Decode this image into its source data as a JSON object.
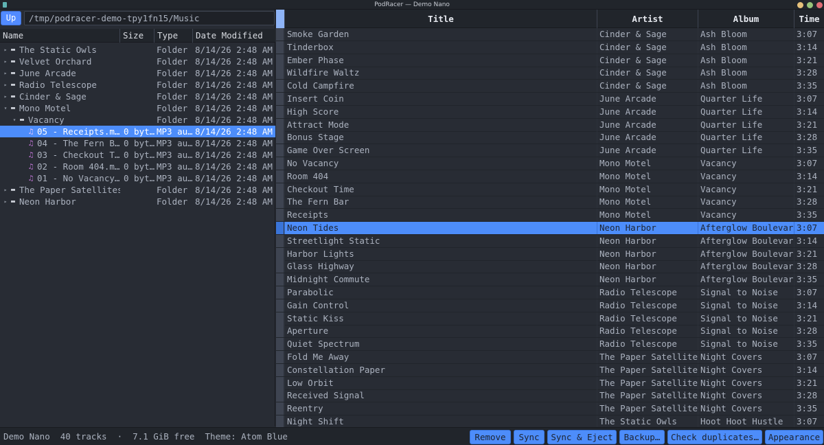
{
  "window": {
    "title": "PodRacer — Demo Nano"
  },
  "browser": {
    "up_label": "Up",
    "path": "/tmp/podracer-demo-tpy1fn15/Music",
    "columns": [
      "Name",
      "Size",
      "Type",
      "Date Modified"
    ],
    "items": [
      {
        "name": "The Static Owls",
        "size": "",
        "type": "Folder",
        "date": "8/14/26 2:48 AM",
        "kind": "folder",
        "expanded": false,
        "depth": 0
      },
      {
        "name": "Velvet Orchard",
        "size": "",
        "type": "Folder",
        "date": "8/14/26 2:48 AM",
        "kind": "folder",
        "expanded": false,
        "depth": 0
      },
      {
        "name": "June Arcade",
        "size": "",
        "type": "Folder",
        "date": "8/14/26 2:48 AM",
        "kind": "folder",
        "expanded": false,
        "depth": 0
      },
      {
        "name": "Radio Telescope",
        "size": "",
        "type": "Folder",
        "date": "8/14/26 2:48 AM",
        "kind": "folder",
        "expanded": false,
        "depth": 0
      },
      {
        "name": "Cinder & Sage",
        "size": "",
        "type": "Folder",
        "date": "8/14/26 2:48 AM",
        "kind": "folder",
        "expanded": false,
        "depth": 0
      },
      {
        "name": "Mono Motel",
        "size": "",
        "type": "Folder",
        "date": "8/14/26 2:48 AM",
        "kind": "folder",
        "expanded": true,
        "depth": 0
      },
      {
        "name": "Vacancy",
        "size": "",
        "type": "Folder",
        "date": "8/14/26 2:48 AM",
        "kind": "folder",
        "expanded": true,
        "depth": 1
      },
      {
        "name": "05 - Receipts.m…",
        "size": "0 byt…",
        "type": "MP3 au…",
        "date": "8/14/26 2:48 AM",
        "kind": "file",
        "depth": 2,
        "selected": true
      },
      {
        "name": "04 - The Fern B…",
        "size": "0 byt…",
        "type": "MP3 au…",
        "date": "8/14/26 2:48 AM",
        "kind": "file",
        "depth": 2
      },
      {
        "name": "03 - Checkout T…",
        "size": "0 byt…",
        "type": "MP3 au…",
        "date": "8/14/26 2:48 AM",
        "kind": "file",
        "depth": 2
      },
      {
        "name": "02 - Room 404.m…",
        "size": "0 byt…",
        "type": "MP3 au…",
        "date": "8/14/26 2:48 AM",
        "kind": "file",
        "depth": 2
      },
      {
        "name": "01 - No Vacancy…",
        "size": "0 byt…",
        "type": "MP3 au…",
        "date": "8/14/26 2:48 AM",
        "kind": "file",
        "depth": 2
      },
      {
        "name": "The Paper Satellites",
        "size": "",
        "type": "Folder",
        "date": "8/14/26 2:48 AM",
        "kind": "folder",
        "expanded": false,
        "depth": 0
      },
      {
        "name": "Neon Harbor",
        "size": "",
        "type": "Folder",
        "date": "8/14/26 2:48 AM",
        "kind": "folder",
        "expanded": false,
        "depth": 0
      }
    ]
  },
  "tracks": {
    "columns": [
      "Title",
      "Artist",
      "Album",
      "Time"
    ],
    "rows": [
      [
        "Smoke Garden",
        "Cinder & Sage",
        "Ash Bloom",
        "3:07"
      ],
      [
        "Tinderbox",
        "Cinder & Sage",
        "Ash Bloom",
        "3:14"
      ],
      [
        "Ember Phase",
        "Cinder & Sage",
        "Ash Bloom",
        "3:21"
      ],
      [
        "Wildfire Waltz",
        "Cinder & Sage",
        "Ash Bloom",
        "3:28"
      ],
      [
        "Cold Campfire",
        "Cinder & Sage",
        "Ash Bloom",
        "3:35"
      ],
      [
        "Insert Coin",
        "June Arcade",
        "Quarter Life",
        "3:07"
      ],
      [
        "High Score",
        "June Arcade",
        "Quarter Life",
        "3:14"
      ],
      [
        "Attract Mode",
        "June Arcade",
        "Quarter Life",
        "3:21"
      ],
      [
        "Bonus Stage",
        "June Arcade",
        "Quarter Life",
        "3:28"
      ],
      [
        "Game Over Screen",
        "June Arcade",
        "Quarter Life",
        "3:35"
      ],
      [
        "No Vacancy",
        "Mono Motel",
        "Vacancy",
        "3:07"
      ],
      [
        "Room 404",
        "Mono Motel",
        "Vacancy",
        "3:14"
      ],
      [
        "Checkout Time",
        "Mono Motel",
        "Vacancy",
        "3:21"
      ],
      [
        "The Fern Bar",
        "Mono Motel",
        "Vacancy",
        "3:28"
      ],
      [
        "Receipts",
        "Mono Motel",
        "Vacancy",
        "3:35"
      ],
      [
        "Neon Tides",
        "Neon Harbor",
        "Afterglow Boulevard",
        "3:07"
      ],
      [
        "Streetlight Static",
        "Neon Harbor",
        "Afterglow Boulevard",
        "3:14"
      ],
      [
        "Harbor Lights",
        "Neon Harbor",
        "Afterglow Boulevard",
        "3:21"
      ],
      [
        "Glass Highway",
        "Neon Harbor",
        "Afterglow Boulevard",
        "3:28"
      ],
      [
        "Midnight Commute",
        "Neon Harbor",
        "Afterglow Boulevard",
        "3:35"
      ],
      [
        "Parabolic",
        "Radio Telescope",
        "Signal to Noise",
        "3:07"
      ],
      [
        "Gain Control",
        "Radio Telescope",
        "Signal to Noise",
        "3:14"
      ],
      [
        "Static Kiss",
        "Radio Telescope",
        "Signal to Noise",
        "3:21"
      ],
      [
        "Aperture",
        "Radio Telescope",
        "Signal to Noise",
        "3:28"
      ],
      [
        "Quiet Spectrum",
        "Radio Telescope",
        "Signal to Noise",
        "3:35"
      ],
      [
        "Fold Me Away",
        "The Paper Satellites",
        "Night Covers",
        "3:07"
      ],
      [
        "Constellation Paper",
        "The Paper Satellites",
        "Night Covers",
        "3:14"
      ],
      [
        "Low Orbit",
        "The Paper Satellites",
        "Night Covers",
        "3:21"
      ],
      [
        "Received Signal",
        "The Paper Satellites",
        "Night Covers",
        "3:28"
      ],
      [
        "Reentry",
        "The Paper Satellites",
        "Night Covers",
        "3:35"
      ],
      [
        "Night Shift",
        "The Static Owls",
        "Hoot Hoot Hustle",
        "3:07"
      ]
    ],
    "selected_index": 15
  },
  "status": {
    "text": "Demo Nano  40 tracks  ·  7.1 GiB free  Theme: Atom Blue",
    "buttons": [
      "Remove",
      "Sync",
      "Sync & Eject",
      "Backup…",
      "Check duplicates…",
      "Appearance"
    ]
  },
  "colors": {
    "accent": "#4d8dfa",
    "background": "#282c34",
    "header": "#21252b",
    "music_icon": "#c678dd"
  }
}
